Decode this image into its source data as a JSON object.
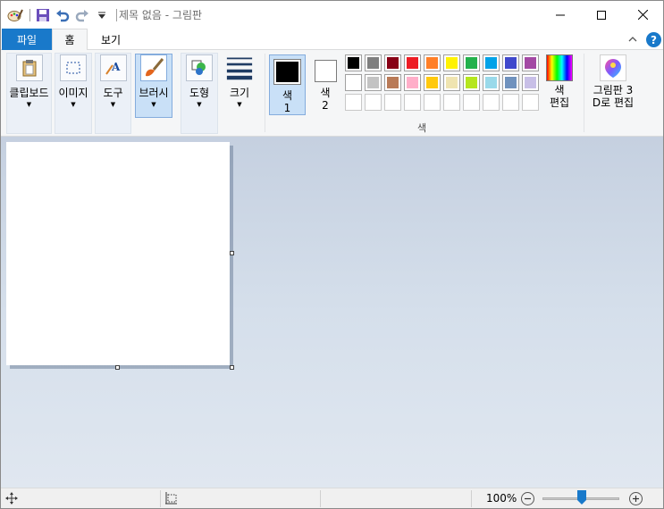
{
  "window": {
    "title": "제목 없음 - 그림판"
  },
  "tabs": {
    "file": "파일",
    "home": "홈",
    "view": "보기"
  },
  "ribbon": {
    "clipboard": "클립보드",
    "image": "이미지",
    "tools": "도구",
    "brushes": "브러시",
    "shapes": "도형",
    "size": "크기",
    "color1_line1": "색",
    "color1_line2": "1",
    "color2_line1": "색",
    "color2_line2": "2",
    "colors_group": "색",
    "edit_colors_line1": "색",
    "edit_colors_line2": "편집",
    "paint3d_line1": "그림판 3",
    "paint3d_line2": "D로 편집",
    "help": "?"
  },
  "palette": {
    "row1": [
      "#000000",
      "#7f7f7f",
      "#880015",
      "#ed1c24",
      "#ff7f27",
      "#fff200",
      "#22b14c",
      "#00a2e8",
      "#3f48cc",
      "#a349a4"
    ],
    "row2": [
      "#ffffff",
      "#c3c3c3",
      "#b97a57",
      "#ffaec9",
      "#ffc90e",
      "#efe4b0",
      "#b5e61d",
      "#99d9ea",
      "#7092be",
      "#c8bfe7"
    ]
  },
  "colors": {
    "accent": "#1979ca",
    "color1": "#000000",
    "color2": "#ffffff"
  },
  "statusbar": {
    "zoom": "100%",
    "zoom_level": 1.0
  }
}
